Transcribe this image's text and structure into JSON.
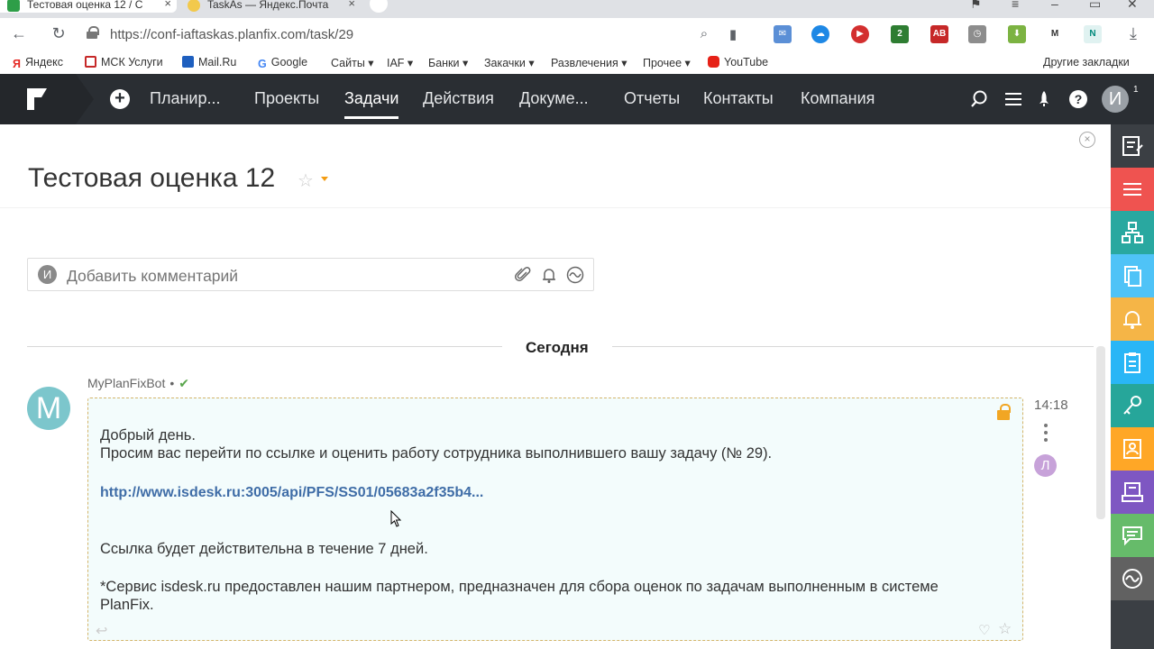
{
  "browser": {
    "tabs": [
      {
        "title": "Тестовая оценка 12 / С",
        "favicon_color": "#2e9e48",
        "favicon_text": "48"
      },
      {
        "title": "TaskAs — Яндекс.Почта",
        "favicon_color": "#f2c94c"
      }
    ],
    "url": "https://conf-iaftaskas.planfix.com/task/29",
    "bookmarks": [
      {
        "label": "Яндекс",
        "color": "#e52620",
        "glyph": "Я"
      },
      {
        "label": "МСК Услуги",
        "color": "#c62828"
      },
      {
        "label": "Mail.Ru",
        "color": "#1e5fbf"
      },
      {
        "label": "Google",
        "color": "#4285f4",
        "glyph": "G"
      },
      {
        "label": "Сайты ▾"
      },
      {
        "label": "IAF ▾"
      },
      {
        "label": "Банки ▾"
      },
      {
        "label": "Закачки ▾"
      },
      {
        "label": "Развлечения ▾"
      },
      {
        "label": "Прочее ▾"
      },
      {
        "label": "YouTube",
        "color": "#e62117"
      }
    ],
    "other_bookmarks": "Другие закладки"
  },
  "nav": {
    "menu": [
      "Планир...",
      "Проекты",
      "Задачи",
      "Действия",
      "Докуме...",
      "Отчеты",
      "Контакты",
      "Компания"
    ],
    "active": "Задачи",
    "user_initial": "И",
    "user_badge": "1"
  },
  "task": {
    "title": "Тестовая оценка 12"
  },
  "comment_box": {
    "avatar_initial": "И",
    "placeholder": "Добавить комментарий"
  },
  "day_separator": "Сегодня",
  "message": {
    "author_initial": "M",
    "author": "MyPlanFixBot",
    "dot": "•",
    "check": "✔",
    "time": "14:18",
    "reader_initial": "Л",
    "greeting": "Добрый день.",
    "line1": "Просим вас перейти по ссылке и оценить работу сотрудника выполнившего вашу задачу (№ 29).",
    "link": "http://www.isdesk.ru:3005/api/PFS/SS01/05683a2f35b4...",
    "line2": "Ссылка будет действительна в течение 7 дней.",
    "line3": "*Сервис isdesk.ru предоставлен нашим партнером, предназначен для сбора оценок по задачам выполненным в системе",
    "line4": "PlanFix."
  },
  "sidebar_colors": [
    "#3b3f44",
    "#ef5350",
    "#29a8a0",
    "#4fc3f7",
    "#f5b547",
    "#29b6f6",
    "#26a69a",
    "#ffa726",
    "#7e57c2",
    "#66bb6a",
    "#616161"
  ],
  "colors": {
    "header_bg": "#2a2e33",
    "accent_link": "#3f6da7",
    "message_bg": "#f3fcfc"
  }
}
